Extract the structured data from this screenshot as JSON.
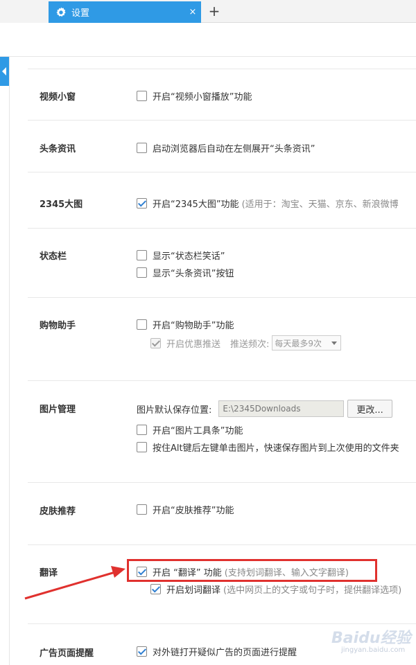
{
  "tab": {
    "title": "设置",
    "close": "×",
    "new_tab": "+"
  },
  "sections": {
    "video": {
      "title": "视频小窗",
      "opt1": "开启“视频小窗播放”功能"
    },
    "news": {
      "title": "头条资讯",
      "opt1": "启动浏览器后自动在左侧展开“头条资讯”"
    },
    "bigimg": {
      "title": "2345大图",
      "opt1": "开启“2345大图”功能",
      "hint": "(适用于：淘宝、天猫、京东、新浪微博"
    },
    "statusbar": {
      "title": "状态栏",
      "opt1": "显示“状态栏笑话”",
      "opt2": "显示“头条资讯”按钮"
    },
    "shopping": {
      "title": "购物助手",
      "opt1": "开启“购物助手”功能",
      "opt2": "开启优惠推送",
      "freq_label": "推送频次:",
      "freq_value": "每天最多9次"
    },
    "images": {
      "title": "图片管理",
      "path_label": "图片默认保存位置:",
      "path_value": "E:\\2345Downloads",
      "change_button": "更改...",
      "opt1": "开启“图片工具条”功能",
      "opt2": "按住Alt键后左键单击图片，快速保存图片到上次使用的文件夹"
    },
    "skin": {
      "title": "皮肤推荐",
      "opt1": "开启“皮肤推荐”功能"
    },
    "translate": {
      "title": "翻译",
      "opt1": "开启 “翻译” 功能",
      "hint1": "(支持划词翻译、输入文字翻译)",
      "opt2": "开启划词翻译",
      "hint2": "(选中网页上的文字或句子时，提供翻译选项)"
    },
    "ads": {
      "title": "广告页面提醒",
      "opt1": "对外链打开疑似广告的页面进行提醒"
    }
  },
  "watermark": {
    "brand": "Baidu经验",
    "site": "jingyan.baidu.com"
  },
  "colors": {
    "accent": "#2f9ae5",
    "highlight": "#e0312e"
  }
}
